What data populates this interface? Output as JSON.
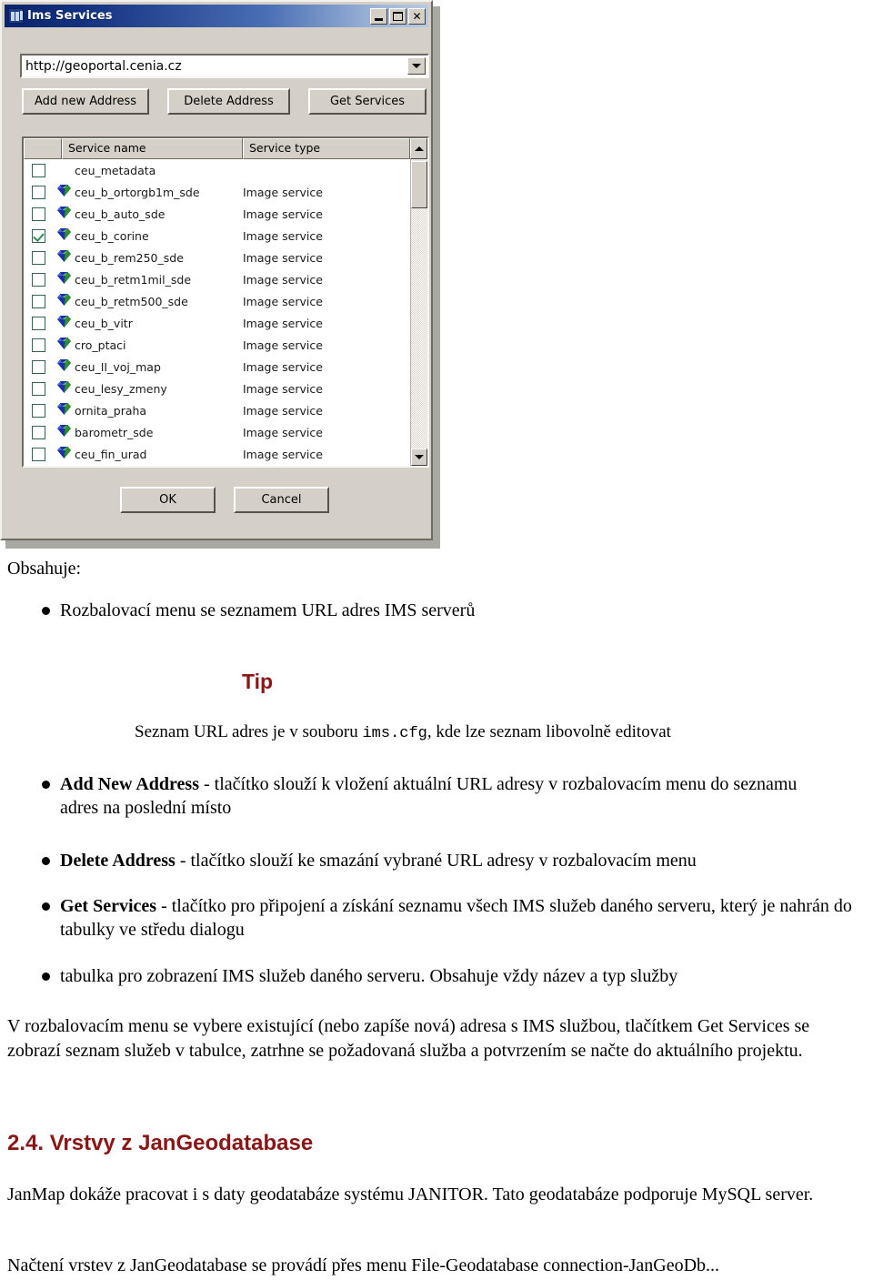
{
  "dialog": {
    "title": "Ims Services",
    "icon": "application-icon",
    "window_controls": [
      {
        "name": "minimize",
        "label": "_"
      },
      {
        "name": "maximize",
        "label": "□"
      },
      {
        "name": "close",
        "label": "✕"
      }
    ],
    "address": {
      "value": "http://geoportal.cenia.cz",
      "placeholder": "http://"
    },
    "buttons": {
      "add_new_address": "Add new Address",
      "delete_address": "Delete Address",
      "get_services": "Get Services",
      "ok": "OK",
      "cancel": "Cancel"
    },
    "table": {
      "columns": [
        "",
        "Service name",
        "Service type"
      ],
      "rows": [
        {
          "checked": false,
          "has_icon": false,
          "name": "ceu_metadata",
          "type": ""
        },
        {
          "checked": false,
          "has_icon": true,
          "name": "ceu_b_ortorgb1m_sde",
          "type": "Image service"
        },
        {
          "checked": false,
          "has_icon": true,
          "name": "ceu_b_auto_sde",
          "type": "Image service"
        },
        {
          "checked": true,
          "has_icon": true,
          "name": "ceu_b_corine",
          "type": "Image service"
        },
        {
          "checked": false,
          "has_icon": true,
          "name": "ceu_b_rem250_sde",
          "type": "Image service"
        },
        {
          "checked": false,
          "has_icon": true,
          "name": "ceu_b_retm1mil_sde",
          "type": "Image service"
        },
        {
          "checked": false,
          "has_icon": true,
          "name": "ceu_b_retm500_sde",
          "type": "Image service"
        },
        {
          "checked": false,
          "has_icon": true,
          "name": "ceu_b_vitr",
          "type": "Image service"
        },
        {
          "checked": false,
          "has_icon": true,
          "name": "cro_ptaci",
          "type": "Image service"
        },
        {
          "checked": false,
          "has_icon": true,
          "name": "ceu_II_voj_map",
          "type": "Image service"
        },
        {
          "checked": false,
          "has_icon": true,
          "name": "ceu_lesy_zmeny",
          "type": "Image service"
        },
        {
          "checked": false,
          "has_icon": true,
          "name": "ornita_praha",
          "type": "Image service"
        },
        {
          "checked": false,
          "has_icon": true,
          "name": "barometr_sde",
          "type": "Image service"
        },
        {
          "checked": false,
          "has_icon": true,
          "name": "ceu_fin_urad",
          "type": "Image service"
        }
      ]
    }
  },
  "document": {
    "obsahuje_label": "Obsahuje:",
    "bullet_1": "Rozbalovací menu se seznamem URL adres IMS serverů",
    "tip_heading": "Tip",
    "tip_line_pre": "Seznam URL adres je v souboru ",
    "tip_line_mono": "ims.cfg",
    "tip_line_post": ", kde lze seznam libovolně editovat",
    "bullet_2_bold": "Add New Address",
    "bullet_2_rest": " - tlačítko slouží k vložení aktuální URL adresy v rozbalovacím menu do seznamu adres na poslední místo",
    "bullet_3_bold": "Delete Address",
    "bullet_3_rest": " - tlačítko slouží ke smazání vybrané URL adresy v rozbalovacím menu",
    "bullet_4_bold": "Get Services",
    "bullet_4_rest": " - tlačítko pro připojení a získání seznamu všech IMS služeb daného serveru, který je nahrán do tabulky ve středu dialogu",
    "bullet_5": "tabulka pro zobrazení IMS služeb daného serveru. Obsahuje vždy název a typ služby",
    "paragraph_1": "V rozbalovacím menu se vybere existující (nebo zapíše nová) adresa s IMS službou, tlačítkem Get Services se zobrazí seznam služeb v tabulce, zatrhne se požadovaná služba a potvrzením se načte do aktuálního projektu.",
    "heading_24": "2.4. Vrstvy z JanGeodatabase",
    "paragraph_2": "JanMap dokáže pracovat i s daty geodatabáze systému JANITOR. Tato geodatabáze podporuje MySQL server.",
    "paragraph_3": "Načtení vrstev z JanGeodatabase se provádí přes menu File-Geodatabase connection-JanGeoDb..."
  },
  "colors": {
    "accent_red": "#8a1616",
    "dialog_face": "#d4d0c8",
    "titlebar_start": "#0a246a",
    "titlebar_end": "#b9c9e3",
    "checkbox_check": "#2e8b57"
  }
}
